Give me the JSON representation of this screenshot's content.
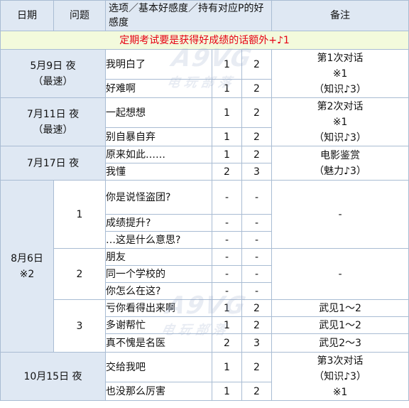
{
  "header": {
    "date": "日期",
    "question": "问题",
    "option": "选项／基本好感度／持有对应P的好感度",
    "note": "备注"
  },
  "banner": "定期考试要是获得好成绩的话额外+♪1",
  "watermark": {
    "logo": "A9VG",
    "sub": "电玩部落"
  },
  "events": [
    {
      "date": "5月9日 夜",
      "sub": "（最速）",
      "rows": [
        {
          "option": "我明白了",
          "base": "1",
          "p": "2"
        },
        {
          "option": "好难啊",
          "base": "1",
          "p": "2"
        }
      ],
      "note": [
        "第1次对话",
        "※1",
        "（知识♪3）"
      ]
    },
    {
      "date": "7月11日 夜",
      "sub": "（最速）",
      "rows": [
        {
          "option": "一起想想",
          "base": "1",
          "p": "2"
        },
        {
          "option": "别自暴自弃",
          "base": "1",
          "p": "2"
        }
      ],
      "note": [
        "第2次对话",
        "※1",
        "（知识♪3）"
      ]
    },
    {
      "date": "7月17日 夜",
      "rows": [
        {
          "option": "原来如此……",
          "base": "1",
          "p": "2"
        },
        {
          "option": "我懂",
          "base": "2",
          "p": "3"
        }
      ],
      "note": [
        "电影鉴赏",
        "（魅力♪3）"
      ]
    },
    {
      "date": "8月6日",
      "sub": "※2",
      "groups": [
        {
          "q": "1",
          "rows": [
            {
              "option": "你是说怪盗团?",
              "base": "-",
              "p": "-"
            },
            {
              "option": "成绩提升?",
              "base": "-",
              "p": "-"
            },
            {
              "option": "…这是什么意思?",
              "base": "-",
              "p": "-"
            }
          ],
          "note": "-"
        },
        {
          "q": "2",
          "rows": [
            {
              "option": "朋友",
              "base": "-",
              "p": "-"
            },
            {
              "option": "同一个学校的",
              "base": "-",
              "p": "-"
            },
            {
              "option": "你怎么在这?",
              "base": "-",
              "p": "-"
            }
          ],
          "note": "-"
        },
        {
          "q": "3",
          "rows": [
            {
              "option": "亏你看得出来啊",
              "base": "1",
              "p": "2",
              "note": "武见1～2"
            },
            {
              "option": "多谢帮忙",
              "base": "1",
              "p": "2",
              "note": "武见1～2"
            },
            {
              "option": "真不愧是名医",
              "base": "2",
              "p": "3",
              "note": "武见2～3"
            }
          ]
        }
      ]
    },
    {
      "date": "10月15日 夜",
      "rows": [
        {
          "option": "交给我吧",
          "base": "1",
          "p": "2"
        },
        {
          "option": "也没那么厉害",
          "base": "1",
          "p": "2"
        }
      ],
      "note": [
        "第3次对话",
        "（知识♪3）",
        "※1"
      ]
    }
  ]
}
